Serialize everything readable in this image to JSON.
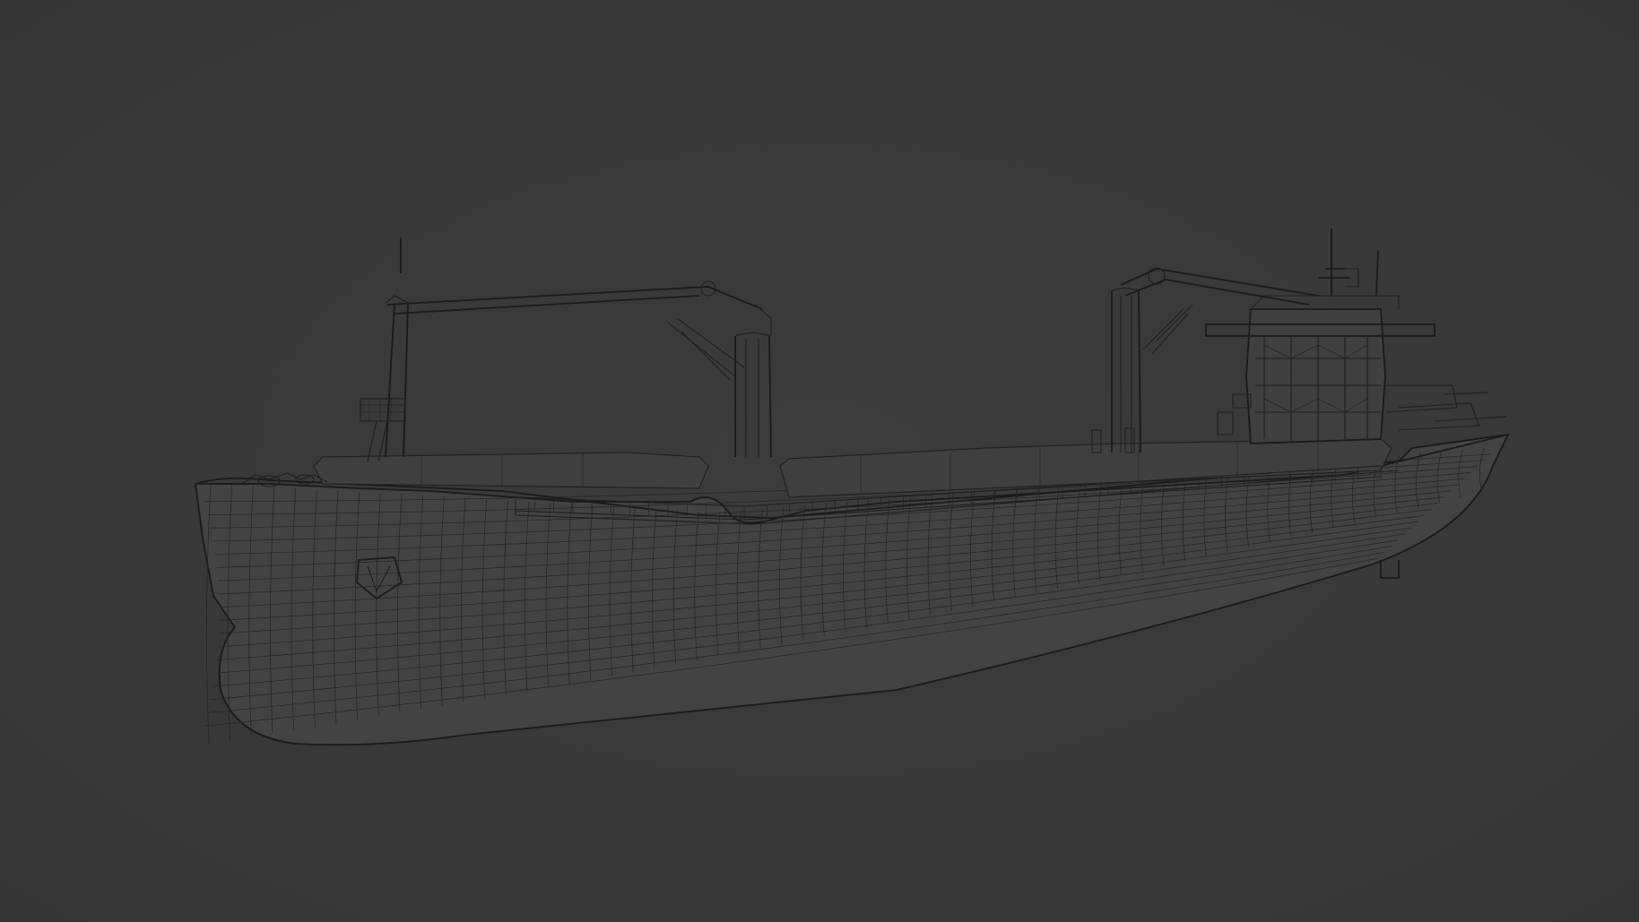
{
  "scene": {
    "background_color": "#3a3a3a",
    "wire_color": "#1e1e1e",
    "hull_color": "#434343"
  },
  "model": {
    "type": "cargo-ship-wireframe",
    "display_mode": "wireframe",
    "cranes": 2
  }
}
